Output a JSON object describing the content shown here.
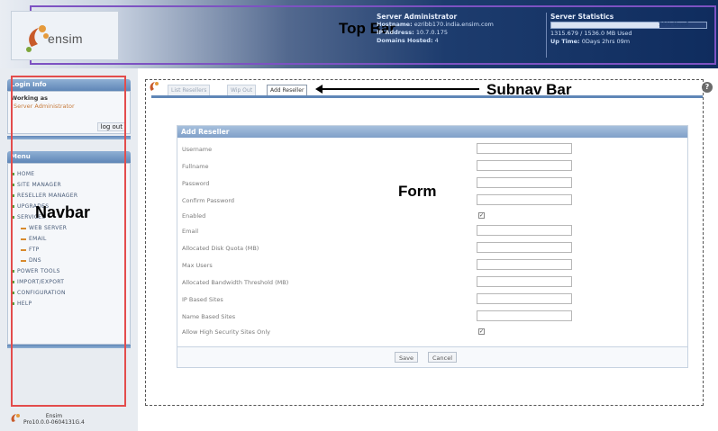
{
  "annotations": {
    "top_bar": "Top Bar",
    "subnav_bar": "Subnav Bar",
    "form": "Form",
    "navbar": "Navbar"
  },
  "brand": {
    "logo_text": "ensim"
  },
  "server_panel": {
    "title": "Server Administrator",
    "hostname_label": "Hostname:",
    "hostname": "ezribb170.india.ensim.com",
    "ip_label": "IP Address:",
    "ip": "10.7.0.175",
    "domains_label": "Domains Hosted:",
    "domains": "4"
  },
  "stats_panel": {
    "title": "Server Statistics",
    "disk_used_label": "70% Used",
    "disk_used_fraction": 0.7,
    "disk_line": "1315.679 / 1536.0 MB Used",
    "uptime_label": "Up Time:",
    "uptime": "0Days 2hrs 09m"
  },
  "login": {
    "header": "Login Info",
    "working_as": "Working as",
    "role": "Server Administrator",
    "logout": "log out"
  },
  "menu": {
    "header": "Menu",
    "items": [
      "HOME",
      "SITE MANAGER",
      "RESELLER MANAGER",
      "UPGRADES",
      "SERVICES"
    ],
    "subitems": [
      "WEB SERVER",
      "EMAIL",
      "FTP",
      "DNS"
    ],
    "items2": [
      "POWER TOOLS",
      "IMPORT/EXPORT",
      "CONFIGURATION",
      "HELP"
    ]
  },
  "footer": {
    "line1": "Ensim",
    "line2": "Pro10.0.0-0604131G.4"
  },
  "subnav": {
    "tabs": [
      "List Resellers",
      "Wip Out",
      "Add Reseller"
    ],
    "active_index": 2
  },
  "form": {
    "title": "Add Reseller",
    "fields": [
      {
        "label": "Username",
        "type": "text",
        "value": ""
      },
      {
        "label": "Fullname",
        "type": "text",
        "value": ""
      },
      {
        "label": "Password",
        "type": "text",
        "value": ""
      },
      {
        "label": "Confirm Password",
        "type": "text",
        "value": ""
      },
      {
        "label": "Enabled",
        "type": "checkbox",
        "checked": true
      },
      {
        "label": "Email",
        "type": "text",
        "value": ""
      },
      {
        "label": "Allocated Disk Quota (MB)",
        "type": "text",
        "value": ""
      },
      {
        "label": "Max Users",
        "type": "text",
        "value": ""
      },
      {
        "label": "Allocated Bandwidth Threshold (MB)",
        "type": "text",
        "value": ""
      },
      {
        "label": "IP Based Sites",
        "type": "text",
        "value": ""
      },
      {
        "label": "Name Based Sites",
        "type": "text",
        "value": ""
      },
      {
        "label": "Allow High Security Sites Only",
        "type": "checkbox",
        "checked": true
      }
    ],
    "save": "Save",
    "cancel": "Cancel"
  },
  "help_icon": "?",
  "colors": {
    "accent": "#5f86b7",
    "navbar_outline": "#e34c4c",
    "topbar_outline": "#7d52c2"
  }
}
